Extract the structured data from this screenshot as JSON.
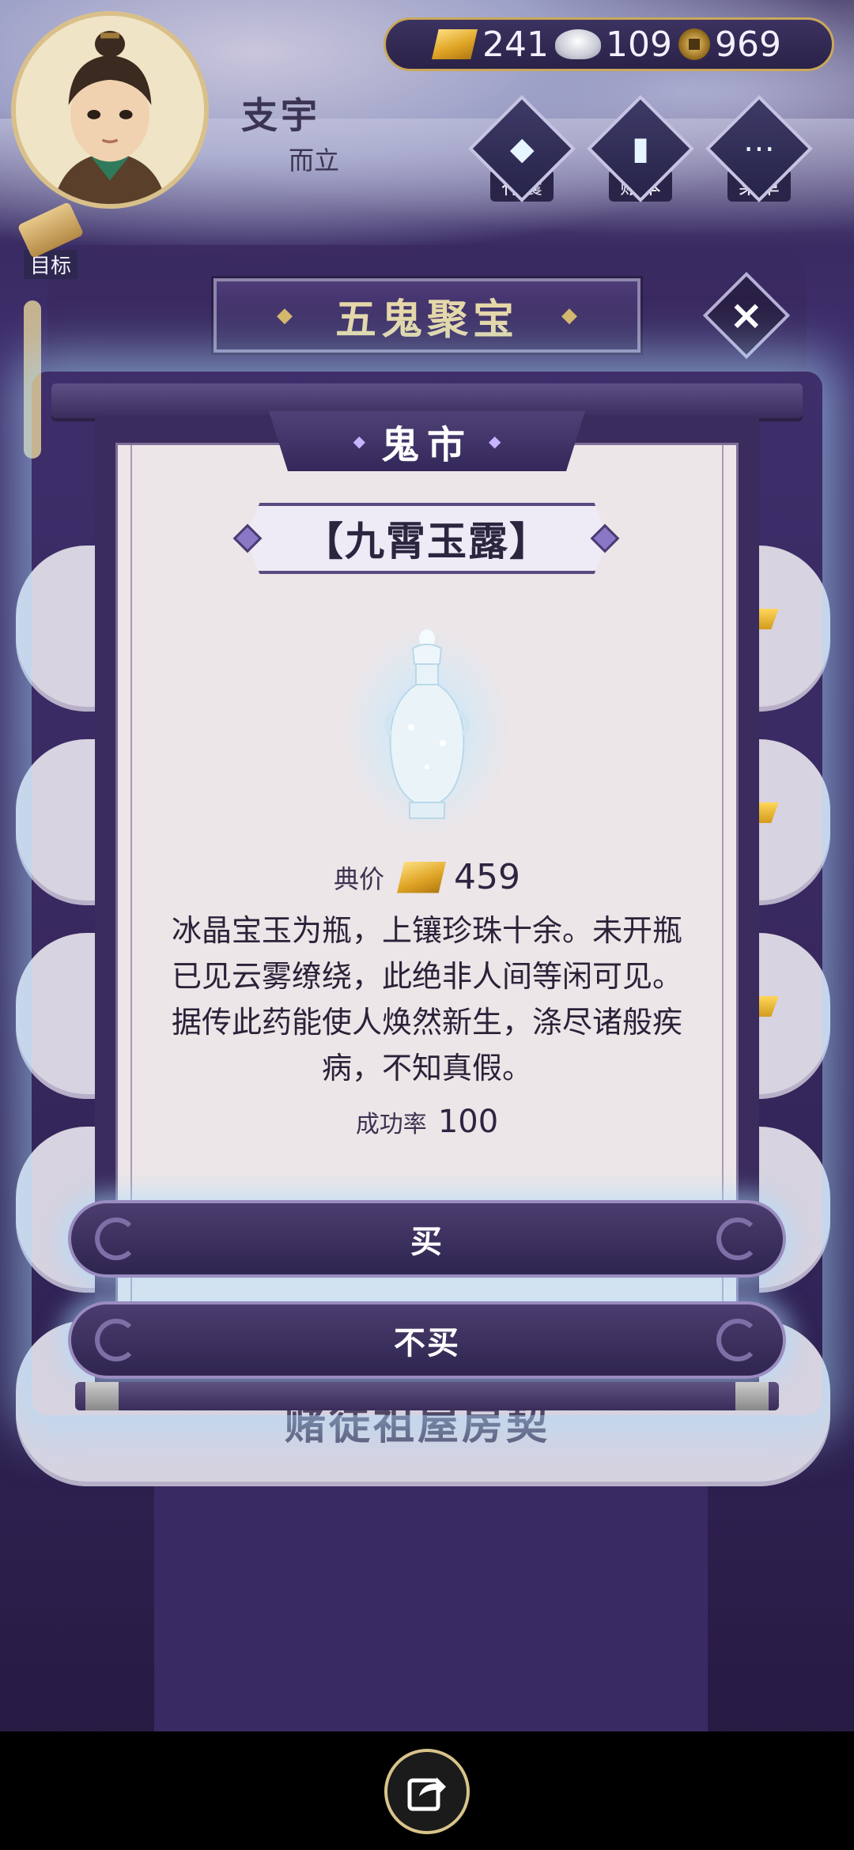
{
  "player": {
    "name": "支宇",
    "title": "而立"
  },
  "currency": {
    "gold": "241",
    "silver": "109",
    "coins": "969"
  },
  "menu": {
    "bag_label": "行囊",
    "ledger_label": "账本",
    "menu_label": "菜单"
  },
  "goal_label": "目标",
  "board_title": "五鬼聚宝",
  "background_caption": "赌徒祖屋房契",
  "modal": {
    "header": "鬼市",
    "item_name": "【九霄玉露】",
    "price_label": "典价",
    "price_value": "459",
    "description": "冰晶宝玉为瓶，上镶珍珠十余。未开瓶已见云雾缭绕，此绝非人间等闲可见。据传此药能使人焕然新生，涤尽诸般疾病，不知真假。",
    "success_label": "成功率",
    "success_value": "100",
    "buy_label": "买",
    "decline_label": "不买"
  },
  "icons": {
    "bag": "bag-icon",
    "ledger": "ledger-icon",
    "menu": "more-icon",
    "close": "close-icon",
    "share": "share-icon",
    "gold": "gold-ingot-icon",
    "silver": "silver-ingot-icon",
    "coin": "copper-coin-icon",
    "item": "jade-vase-icon"
  },
  "colors": {
    "accent_gold": "#d9c08a",
    "panel_purple": "#3a2c5c",
    "paper": "#ece6e8"
  }
}
